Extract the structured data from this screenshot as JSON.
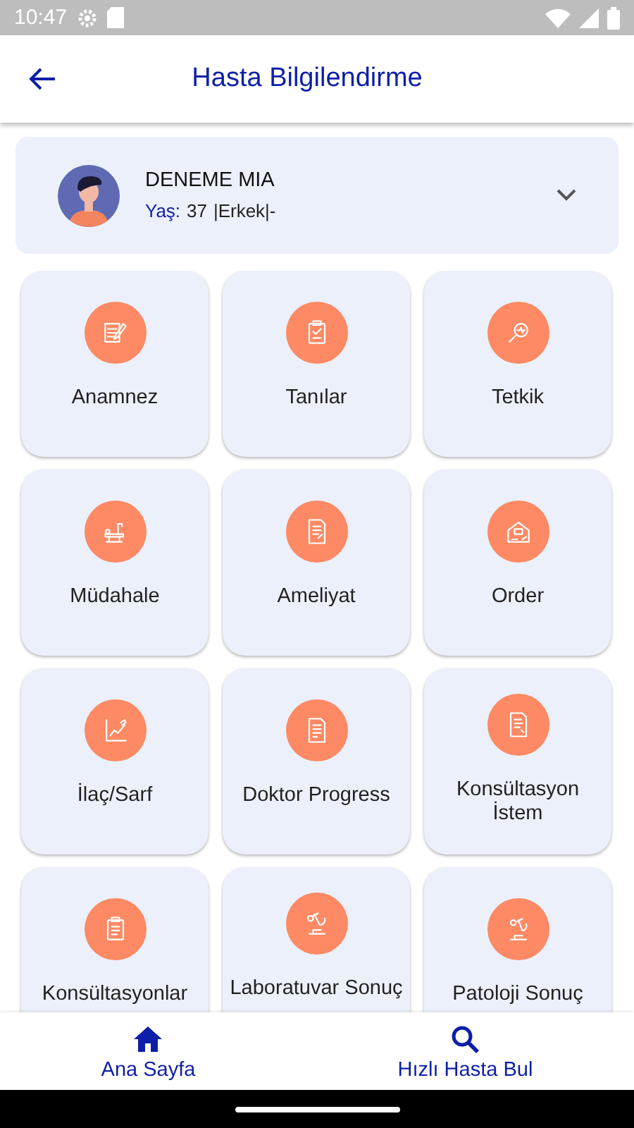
{
  "status_bar": {
    "time": "10:47"
  },
  "header": {
    "title": "Hasta Bilgilendirme"
  },
  "patient": {
    "name": "DENEME MIA",
    "age_label": "Yaş:",
    "age": "37",
    "details": "|Erkek|-"
  },
  "menu": [
    {
      "label": "Anamnez"
    },
    {
      "label": "Tanılar"
    },
    {
      "label": "Tetkik"
    },
    {
      "label": "Müdahale"
    },
    {
      "label": "Ameliyat"
    },
    {
      "label": "Order"
    },
    {
      "label": "İlaç/Sarf"
    },
    {
      "label": "Doktor Progress"
    },
    {
      "label": "Konsültasyon İstem"
    },
    {
      "label": "Konsültasyonlar"
    },
    {
      "label": "Laboratuvar Sonuç"
    },
    {
      "label": "Patoloji Sonuç"
    }
  ],
  "bottom_nav": [
    {
      "label": "Ana Sayfa",
      "kind": "home"
    },
    {
      "label": "Hızlı Hasta Bul",
      "kind": "search"
    }
  ]
}
